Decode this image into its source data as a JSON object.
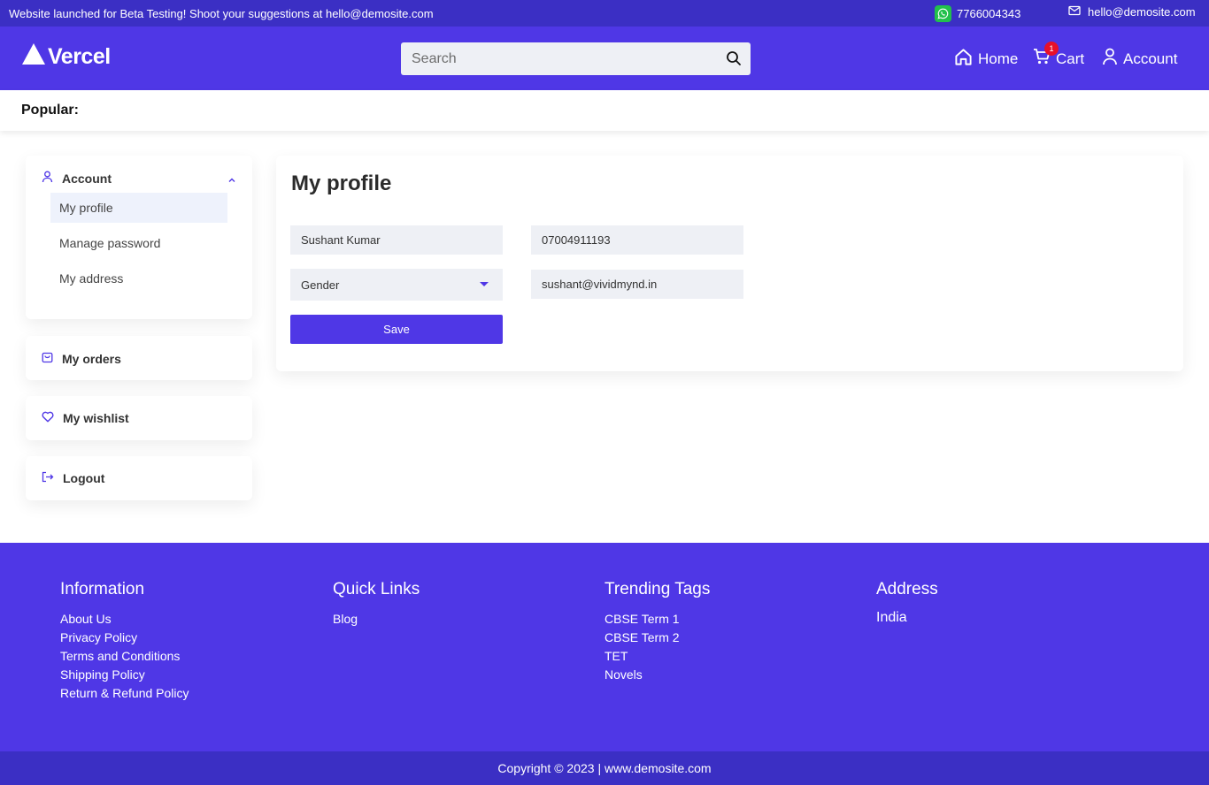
{
  "topbar": {
    "announcement": "Website launched for Beta Testing! Shoot your suggestions at hello@demosite.com",
    "phone": "7766004343",
    "email": "hello@demosite.com"
  },
  "header": {
    "logo_text": "Vercel",
    "search_placeholder": "Search",
    "nav": {
      "home": "Home",
      "cart": "Cart",
      "cart_count": "1",
      "account": "Account"
    }
  },
  "popular": {
    "label": "Popular:"
  },
  "sidebar": {
    "account_label": "Account",
    "account_items": [
      {
        "label": "My profile",
        "active": true
      },
      {
        "label": "Manage password",
        "active": false
      },
      {
        "label": "My address",
        "active": false
      }
    ],
    "orders_label": "My orders",
    "wishlist_label": "My wishlist",
    "logout_label": "Logout"
  },
  "profile": {
    "title": "My profile",
    "name": "Sushant Kumar",
    "phone": "07004911193",
    "gender_placeholder": "Gender",
    "email": "sushant@vividmynd.in",
    "save_label": "Save"
  },
  "footer": {
    "columns": [
      {
        "title": "Information",
        "links": [
          "About Us",
          "Privacy Policy",
          "Terms and Conditions",
          "Shipping Policy",
          "Return & Refund Policy"
        ]
      },
      {
        "title": "Quick Links",
        "links": [
          "Blog"
        ]
      },
      {
        "title": "Trending Tags",
        "links": [
          "CBSE Term 1",
          "CBSE Term 2",
          "TET",
          "Novels"
        ]
      },
      {
        "title": "Address",
        "text": "India"
      }
    ],
    "copyright": "Copyright © 2023 | www.demosite.com"
  },
  "colors": {
    "primary": "#4f37e6",
    "topbar": "#3b2fc4",
    "badge": "#e8102a",
    "whatsapp": "#22c04c"
  }
}
